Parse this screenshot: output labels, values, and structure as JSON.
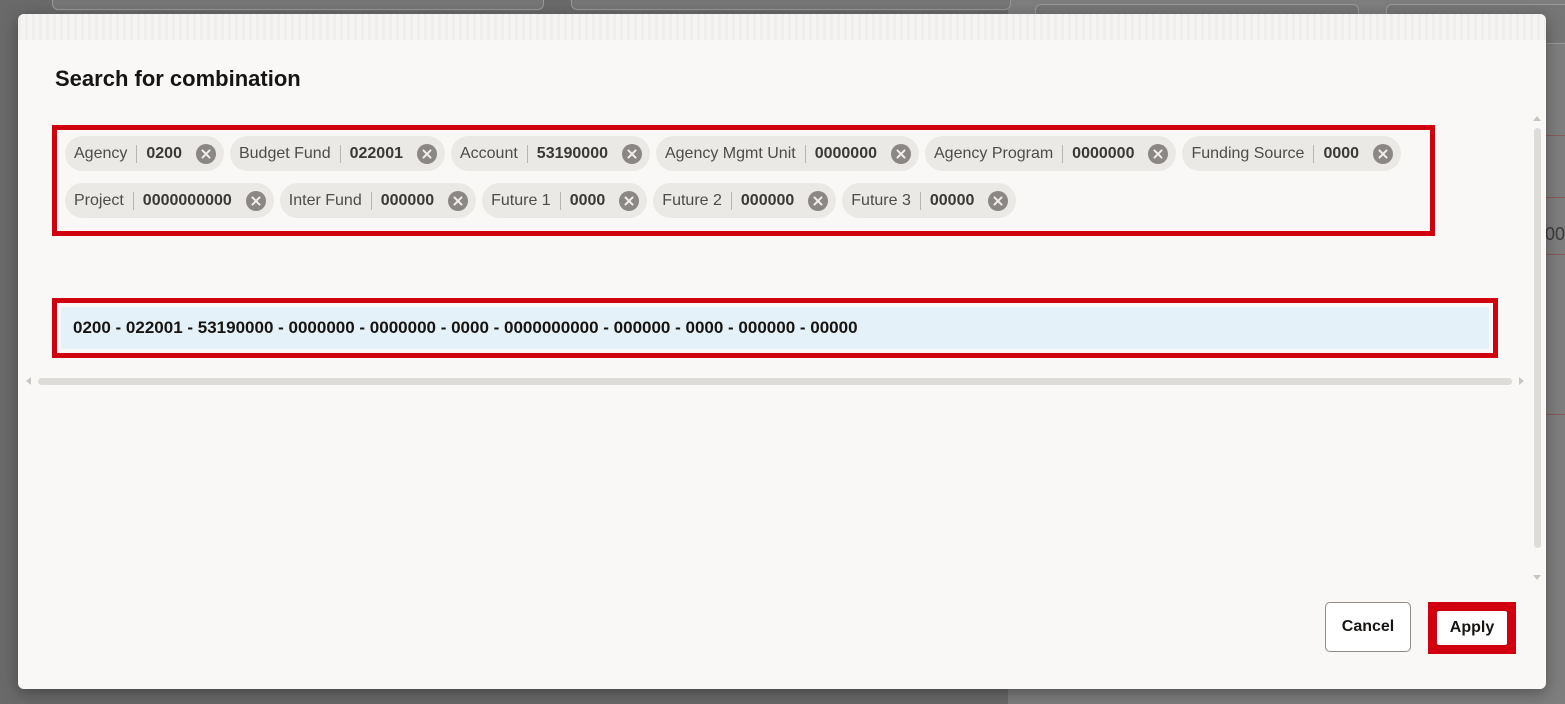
{
  "modal": {
    "title": "Search for combination"
  },
  "chips": [
    [
      {
        "label": "Agency",
        "value": "0200"
      },
      {
        "label": "Budget Fund",
        "value": "022001"
      },
      {
        "label": "Account",
        "value": "53190000"
      },
      {
        "label": "Agency Mgmt Unit",
        "value": "0000000"
      },
      {
        "label": "Agency Program",
        "value": "0000000"
      },
      {
        "label": "Funding Source",
        "value": "0000"
      }
    ],
    [
      {
        "label": "Project",
        "value": "0000000000"
      },
      {
        "label": "Inter Fund",
        "value": "000000"
      },
      {
        "label": "Future 1",
        "value": "0000"
      },
      {
        "label": "Future 2",
        "value": "000000"
      },
      {
        "label": "Future 3",
        "value": "00000"
      }
    ]
  ],
  "result": {
    "combination": "0200 - 022001 - 53190000 - 0000000 - 0000000 - 0000 - 0000000000 - 000000 - 0000 - 000000 - 00000"
  },
  "footer": {
    "cancel_label": "Cancel",
    "apply_label": "Apply"
  },
  "background": {
    "partial_text": "00"
  },
  "colors": {
    "highlight": "#d0000f",
    "selected_row": "#e4f1f9"
  }
}
